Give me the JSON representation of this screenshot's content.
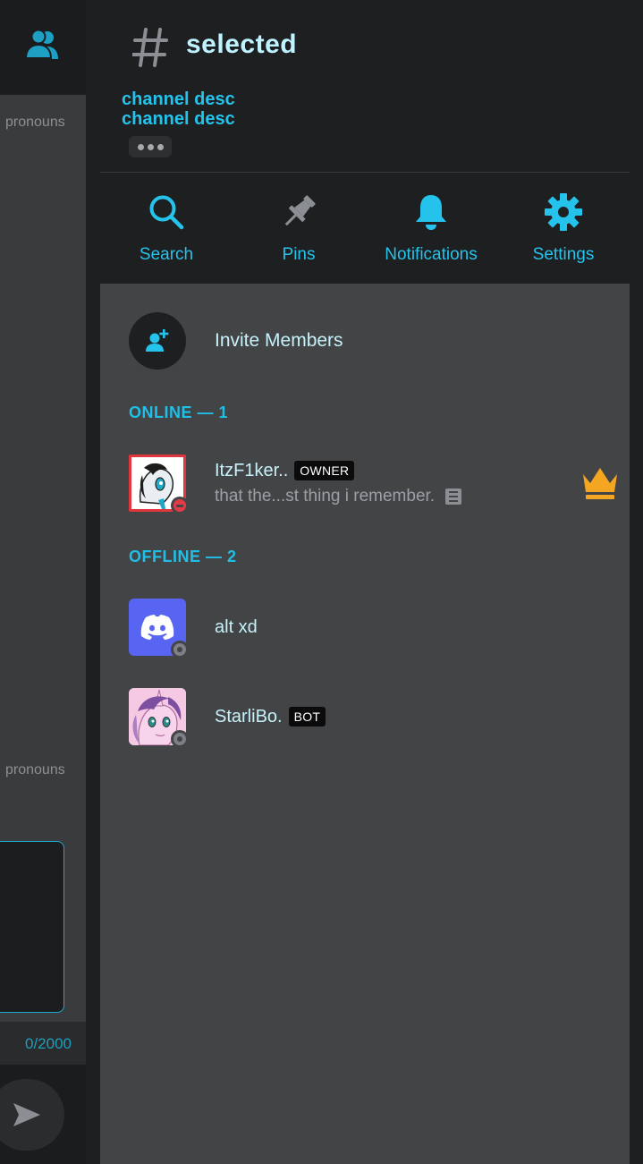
{
  "left": {
    "pronouns_top": "pronouns",
    "pronouns_bottom": "pronouns",
    "char_count": "0/2000"
  },
  "header": {
    "channel_name": "selected",
    "desc_line1": "channel desc",
    "desc_line2": "channel desc"
  },
  "actions": [
    {
      "label": "Search",
      "icon": "search-icon"
    },
    {
      "label": "Pins",
      "icon": "pin-icon"
    },
    {
      "label": "Notifications",
      "icon": "bell-icon"
    },
    {
      "label": "Settings",
      "icon": "gear-icon"
    }
  ],
  "invite": {
    "label": "Invite Members"
  },
  "sections": {
    "online": "ONLINE — 1",
    "offline": "OFFLINE — 2"
  },
  "members": [
    {
      "name": "ItzF1ker..",
      "tag": "OWNER",
      "status_text": "that the...st thing i remember.",
      "presence": "dnd",
      "crown": true
    },
    {
      "name": "alt xd",
      "presence": "offline"
    },
    {
      "name": "StarliBo.",
      "tag": "BOT",
      "presence": "offline"
    }
  ],
  "colors": {
    "accent": "#25c3ec",
    "channel_name": "#bff3ff",
    "crown": "#f4a623",
    "dnd": "#e23b45",
    "discord_blurple": "#5865f2"
  }
}
